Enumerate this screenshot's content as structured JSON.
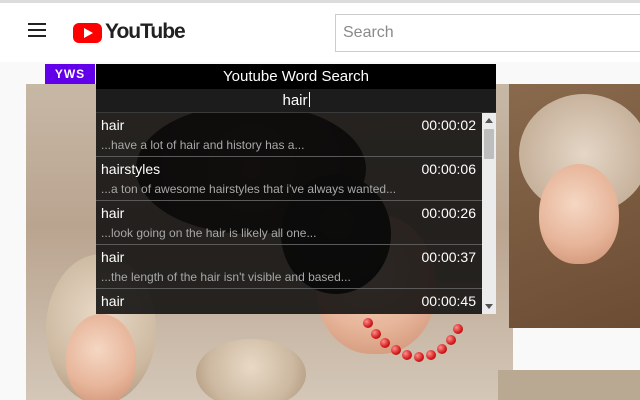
{
  "header": {
    "logo_text": "YouTube",
    "search_placeholder": "Search"
  },
  "extension": {
    "tag": "YWS",
    "title": "Youtube Word Search",
    "query": "hair",
    "results": [
      {
        "word": "hair",
        "time": "00:00:02",
        "context": "...have a lot of hair and history has a..."
      },
      {
        "word": "hairstyles",
        "time": "00:00:06",
        "context": "...a ton of awesome hairstyles that i've always wanted..."
      },
      {
        "word": "hair",
        "time": "00:00:26",
        "context": "...look going on the hair is likely all one..."
      },
      {
        "word": "hair",
        "time": "00:00:37",
        "context": "...the length of the hair isn't visible and based..."
      },
      {
        "word": "hair",
        "time": "00:00:45",
        "context": ""
      }
    ]
  },
  "icons": {
    "menu": "hamburger-menu-icon",
    "logo": "youtube-play-icon"
  },
  "colors": {
    "accent": "#6200ea",
    "youtube_red": "#ff0000",
    "panel_bg": "#0a0a0a"
  }
}
